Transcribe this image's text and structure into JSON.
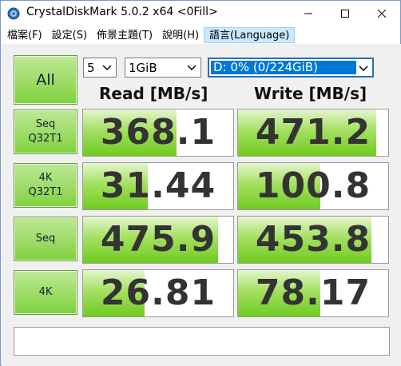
{
  "window": {
    "title": "CrystalDiskMark 5.0.2 x64 <0Fill>"
  },
  "menu": [
    {
      "label": "檔案(F)"
    },
    {
      "label": "設定(S)"
    },
    {
      "label": "佈景主題(T)"
    },
    {
      "label": "說明(H)"
    },
    {
      "label": "語言(Language)"
    }
  ],
  "controls": {
    "all_label": "All",
    "count": "5",
    "size": "1GiB",
    "drive": "D: 0% (0/224GiB)"
  },
  "columns": {
    "read": "Read [MB/s]",
    "write": "Write [MB/s]"
  },
  "tests": [
    {
      "label1": "Seq",
      "label2": "Q32T1",
      "read": "368.1",
      "write": "471.2",
      "read_fill": 0.62,
      "write_fill": 0.92
    },
    {
      "label1": "4K",
      "label2": "Q32T1",
      "read": "31.44",
      "write": "100.8",
      "read_fill": 0.43,
      "write_fill": 0.55
    },
    {
      "label1": "Seq",
      "label2": "",
      "read": "475.9",
      "write": "453.8",
      "read_fill": 0.9,
      "write_fill": 0.89
    },
    {
      "label1": "4K",
      "label2": "",
      "read": "26.81",
      "write": "78.17",
      "read_fill": 0.41,
      "write_fill": 0.55
    }
  ],
  "colors": {
    "accent": "#0078d7",
    "bar_green": "#7fd23e"
  }
}
